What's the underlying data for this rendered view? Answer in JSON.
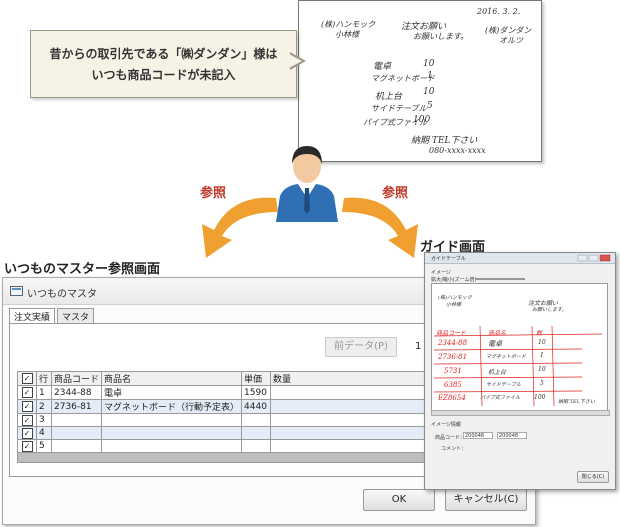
{
  "sheet": {
    "date": "2016. 3. 2.",
    "from_company": "(株)ダンダン",
    "from_person": "オルツ",
    "to_company": "(株)ハンモック",
    "to_dept": "小林様",
    "request_line1": "注文お願い",
    "request_line2": "お願いします。",
    "items": [
      {
        "name": "電卓",
        "qty": "10"
      },
      {
        "name": "マグネットボード",
        "qty": "1"
      },
      {
        "name": "机上台",
        "qty": "10"
      },
      {
        "name": "サイドテーブル",
        "qty": "5"
      },
      {
        "name": "パイプ式ファイル",
        "qty": "100"
      }
    ],
    "footer1": "納期 TEL下さい",
    "footer2": "080-xxxx-xxxx"
  },
  "bubble": {
    "line1": "昔からの取引先である「㈱ダンダン」様は",
    "line2": "いつも商品コードが未記入"
  },
  "labels": {
    "ref_left": "参照",
    "ref_right": "参照",
    "left_screen": "いつものマスター参照画面",
    "right_screen": "ガイド画面"
  },
  "master_window": {
    "title": "いつものマスタ",
    "tabs": [
      "注文実績",
      "マスタ"
    ],
    "prev_button": "前データ(P)",
    "page_hint": "1",
    "columns": [
      "✓",
      "行",
      "商品コード",
      "商品名",
      "単価",
      "数量"
    ],
    "rows": [
      {
        "check": "✓",
        "line": "1",
        "code": "2344-88",
        "name": "電卓",
        "price": "1590",
        "qty": ""
      },
      {
        "check": "✓",
        "line": "2",
        "code": "2736-81",
        "name": "マグネットボード（行動予定表）",
        "price": "4440",
        "qty": ""
      },
      {
        "check": "✓",
        "line": "3",
        "code": "",
        "name": "",
        "price": "",
        "qty": ""
      },
      {
        "check": "✓",
        "line": "4",
        "code": "",
        "name": "",
        "price": "",
        "qty": ""
      },
      {
        "check": "✓",
        "line": "5",
        "code": "",
        "name": "",
        "price": "",
        "qty": ""
      }
    ],
    "ok_button": "OK",
    "cancel_button": "キャンセル(C)"
  },
  "guide_window": {
    "title": "ガイドテーブル",
    "image_label": "イメージ",
    "zoom_label": "拡大/縮小(ズーム倍)",
    "red_header": [
      "商品コード",
      "商品名",
      "数"
    ],
    "codes": [
      "2344-88",
      "2736-81",
      "5731",
      "6385",
      "EZ8654"
    ],
    "info_label": "イメージ情報",
    "product_code_label": "商品コード：",
    "product_code_value1": "200048",
    "product_code_value2": "200048",
    "comment_label": "コメント：",
    "close_button": "閉じる(C)"
  },
  "colors": {
    "accent_red": "#c0392b",
    "arrow_orange": "#f0a030",
    "row_alt": "#e4edf7"
  }
}
